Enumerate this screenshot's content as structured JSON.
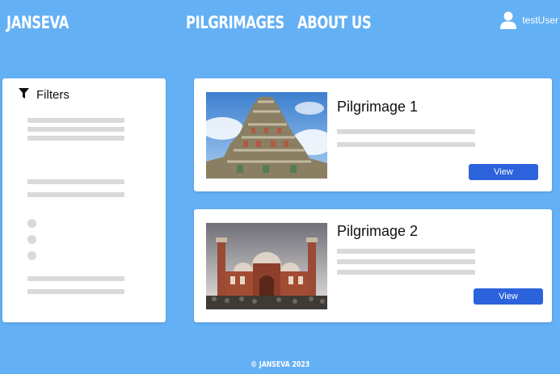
{
  "header": {
    "brand": "JANSEVA",
    "nav": [
      "PILGRIMAGES",
      "ABOUT US"
    ],
    "user": {
      "name": "testUser",
      "icon": "user-icon"
    }
  },
  "filters": {
    "title": "Filters",
    "icon": "filter-icon"
  },
  "pilgrimages": [
    {
      "title": "Pilgrimage 1",
      "button_label": "View",
      "image": "temple-gopuram-photo"
    },
    {
      "title": "Pilgrimage 2",
      "button_label": "View",
      "image": "mosque-photo"
    }
  ],
  "footer": {
    "text": "© JANSEVA 2023"
  },
  "colors": {
    "background": "#64b0f4",
    "button": "#2c63dc",
    "placeholder": "#d9d9d9",
    "card": "#ffffff"
  }
}
